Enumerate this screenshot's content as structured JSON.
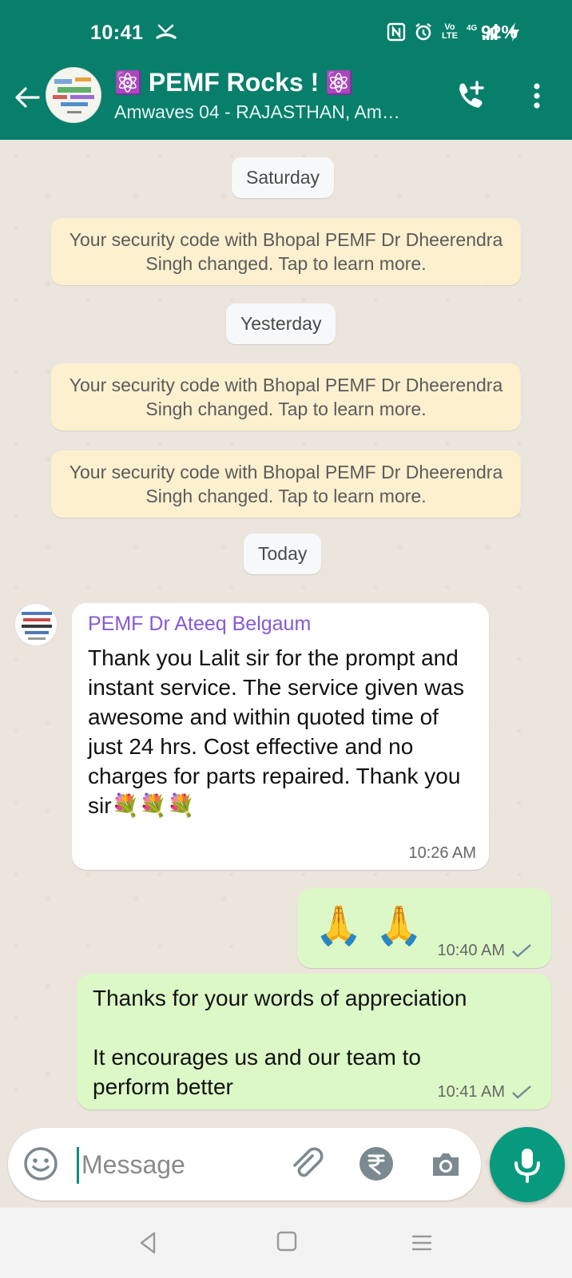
{
  "status_bar": {
    "time": "10:41",
    "battery": "92%",
    "network": "4G",
    "volte": "Vo LTE"
  },
  "header": {
    "title": "PEMF Rocks !",
    "subtitle": "Amwaves 04 - RAJASTHAN, Am…",
    "title_emoji_left": "⚛️",
    "title_emoji_right": "⚛️"
  },
  "chat": {
    "dates": {
      "saturday": "Saturday",
      "yesterday": "Yesterday",
      "today": "Today"
    },
    "system_messages": [
      "Your security code with Bhopal PEMF Dr Dheerendra Singh changed. Tap to learn more.",
      "Your security code with Bhopal PEMF Dr Dheerendra Singh changed. Tap to learn more.",
      "Your security code with Bhopal PEMF Dr Dheerendra Singh changed. Tap to learn more."
    ],
    "incoming": {
      "sender": "PEMF Dr Ateeq Belgaum",
      "text": "Thank you Lalit sir for the prompt and instant service. The service given was awesome and within quoted time of just 24 hrs. Cost effective and no charges for parts repaired. Thank you sir💐💐💐",
      "time": "10:26 AM"
    },
    "outgoing": [
      {
        "text": "🙏🙏",
        "time": "10:40 AM"
      },
      {
        "text_line1": "Thanks for your words of appreciation",
        "text_line2": "It encourages us and our team to perform better",
        "time": "10:41 AM"
      }
    ]
  },
  "composer": {
    "placeholder": "Message"
  },
  "colors": {
    "header": "#077f6b",
    "chat_bg": "#ece5dd",
    "incoming_bubble": "#ffffff",
    "outgoing_bubble": "#dcf8c6",
    "system_bubble": "#fcf0cf",
    "accent": "#079a7f",
    "sender_name": "#8659d6"
  },
  "icons": {
    "missed_call": "missed-call-icon",
    "nfc": "nfc-icon",
    "alarm": "alarm-icon",
    "signal": "signal-icon",
    "charging": "charging-icon",
    "back": "back-arrow-icon",
    "add_call": "add-call-icon",
    "menu": "more-vert-icon",
    "emoji": "emoji-icon",
    "attach": "paperclip-icon",
    "payment": "rupee-icon",
    "camera": "camera-icon",
    "mic": "mic-icon"
  }
}
